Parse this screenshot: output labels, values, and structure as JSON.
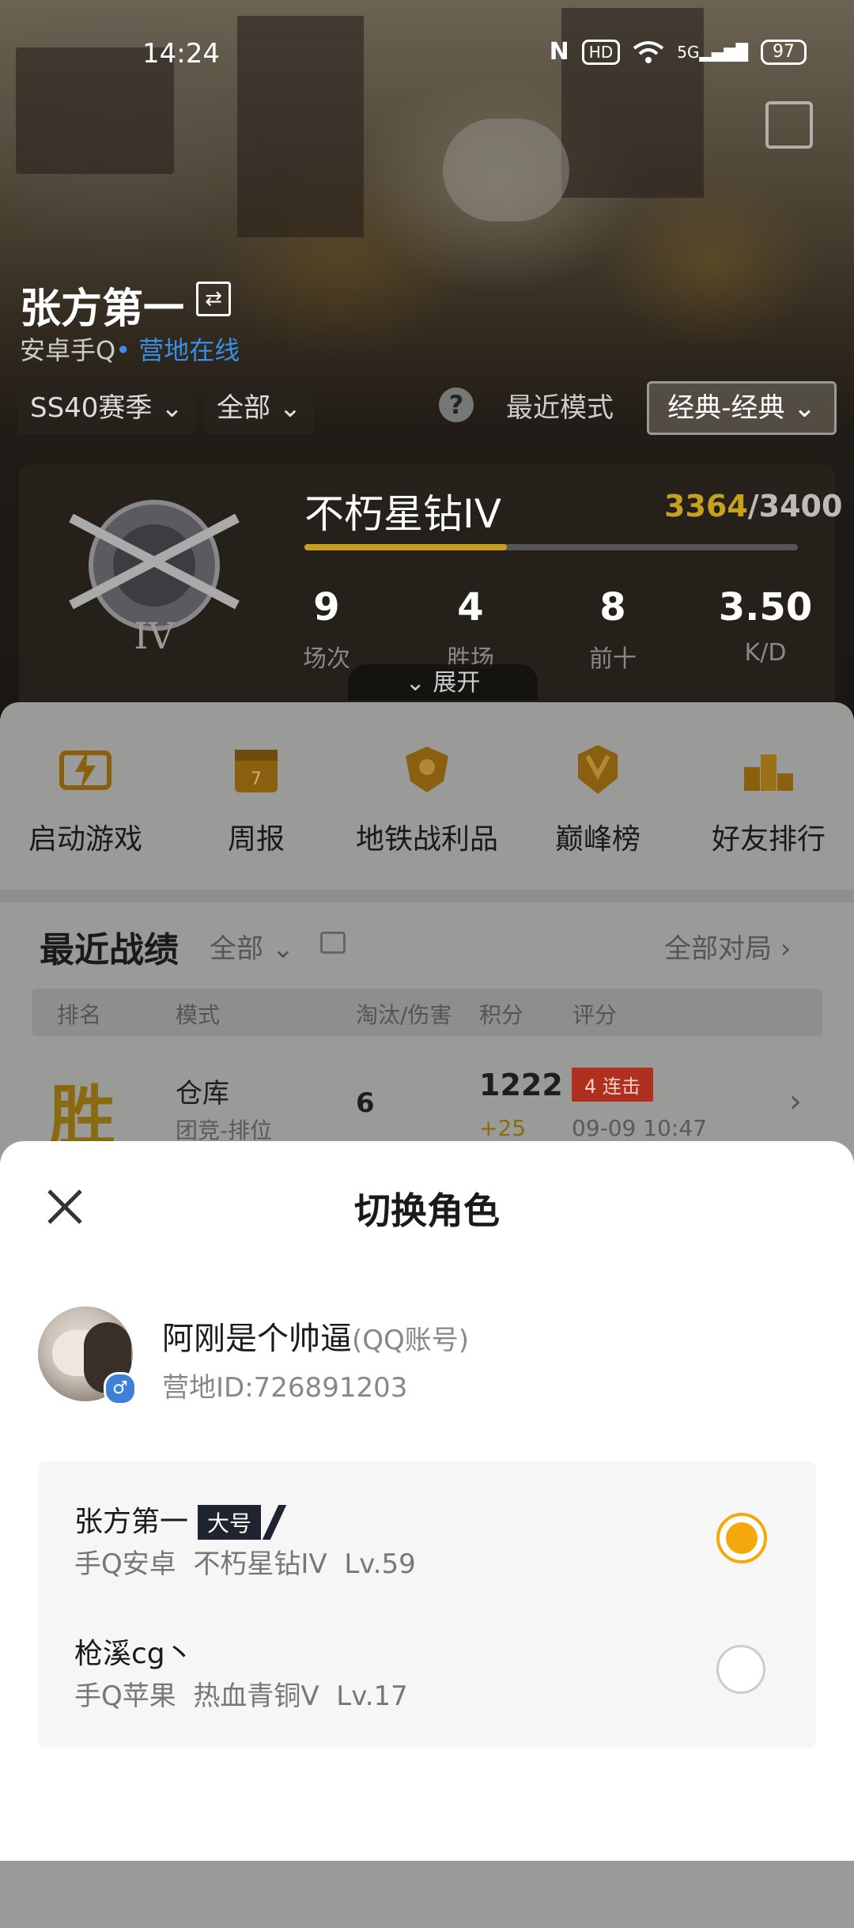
{
  "status_bar": {
    "time": "14:24",
    "battery": "97",
    "hd": "HD",
    "network": "5G"
  },
  "header": {
    "player_name": "张方第一",
    "platform": "安卓手Q",
    "online_status": "• 营地在线"
  },
  "filters": {
    "season": "SS40赛季",
    "range": "全部",
    "recent_mode_label": "最近模式",
    "mode": "经典-经典"
  },
  "rank_card": {
    "rank_name": "不朽星钻IV",
    "points_current": "3364",
    "points_total": "/3400",
    "progress": 0.41,
    "emblem_tier": "IV",
    "stats": [
      {
        "value": "9",
        "label": "场次"
      },
      {
        "value": "4",
        "label": "胜场"
      },
      {
        "value": "8",
        "label": "前十"
      },
      {
        "value": "3.50",
        "label": "K/D"
      }
    ],
    "expand_label": "展开"
  },
  "quick_actions": [
    {
      "label": "启动游戏",
      "icon": "lightning-icon"
    },
    {
      "label": "周报",
      "icon": "calendar-icon"
    },
    {
      "label": "地铁战利品",
      "icon": "loot-shield-icon"
    },
    {
      "label": "巅峰榜",
      "icon": "peak-badge-icon"
    },
    {
      "label": "好友排行",
      "icon": "podium-icon"
    }
  ],
  "recent": {
    "title": "最近战绩",
    "filter": "全部",
    "all_matches": "全部对局",
    "columns": [
      "排名",
      "模式",
      "淘汰/伤害",
      "积分",
      "评分"
    ],
    "row": {
      "result": "胜",
      "map": "仓库",
      "mode": "团竞-排位",
      "kills": "6",
      "score": "1222",
      "delta": "+25",
      "streak": "4 连击",
      "time": "09-09 10:47"
    }
  },
  "sheet": {
    "title": "切换角色",
    "user_name": "阿刚是个帅逼",
    "account_type": "(QQ账号)",
    "camp_id": "营地ID:726891203",
    "gender_symbol": "♂",
    "roles": [
      {
        "name": "张方第一",
        "badge": "大号",
        "platform": "手Q安卓",
        "rank": "不朽星钻IV",
        "level": "Lv.59",
        "selected": true
      },
      {
        "name": "枪溪cg丶",
        "badge": "",
        "platform": "手Q苹果",
        "rank": "热血青铜V",
        "level": "Lv.17",
        "selected": false
      }
    ]
  },
  "colors": {
    "accent": "#f5a80b",
    "link": "#3a8ee6",
    "gold": "#c8a020"
  }
}
